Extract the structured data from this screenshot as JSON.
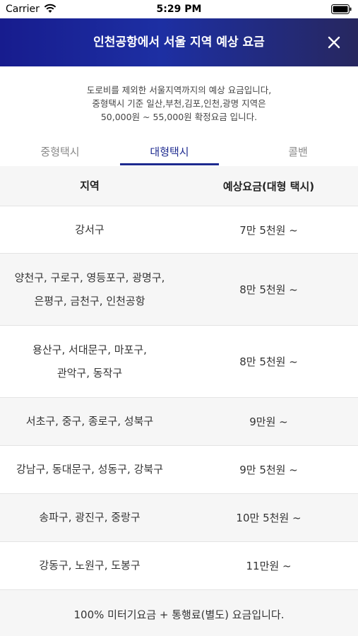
{
  "status_bar": {
    "carrier": "Carrier",
    "time": "5:29 PM"
  },
  "header": {
    "title": "인천공항에서 서울 지역 예상 요금",
    "close_icon": "close-icon"
  },
  "notice": {
    "line1": "도로비를 제외한 서울지역까지의 예상 요금입니다,",
    "line2": "중형택시 기준 일산,부천,김포,인천,광명 지역은",
    "line3": "50,000원 ~ 55,000원 확정요금 입니다."
  },
  "tabs": [
    {
      "label": "중형택시",
      "active": false
    },
    {
      "label": "대형택시",
      "active": true
    },
    {
      "label": "콜밴",
      "active": false
    }
  ],
  "table": {
    "headers": {
      "region": "지역",
      "fare": "예상요금(대형 택시)"
    },
    "rows": [
      {
        "region_line1": "강서구",
        "region_line2": "",
        "fare": "7만 5천원 ~"
      },
      {
        "region_line1": "양천구, 구로구, 영등포구, 광명구,",
        "region_line2": "은평구, 금천구, 인천공항",
        "fare": "8만 5천원 ~"
      },
      {
        "region_line1": "용산구, 서대문구, 마포구,",
        "region_line2": "관악구, 동작구",
        "fare": "8만 5천원 ~"
      },
      {
        "region_line1": "서초구, 중구, 종로구, 성북구",
        "region_line2": "",
        "fare": "9만원 ~"
      },
      {
        "region_line1": "강남구, 동대문구, 성동구, 강북구",
        "region_line2": "",
        "fare": "9만 5천원 ~"
      },
      {
        "region_line1": "송파구, 광진구, 중랑구",
        "region_line2": "",
        "fare": "10만 5천원 ~"
      },
      {
        "region_line1": "강동구, 노원구, 도봉구",
        "region_line2": "",
        "fare": "11만원 ~"
      }
    ],
    "footer": "100% 미터기요금 + 통행료(별도) 요금입니다."
  },
  "colors": {
    "header_start": "#171c8e",
    "header_end": "#27275f",
    "accent": "#1d2a8f"
  }
}
